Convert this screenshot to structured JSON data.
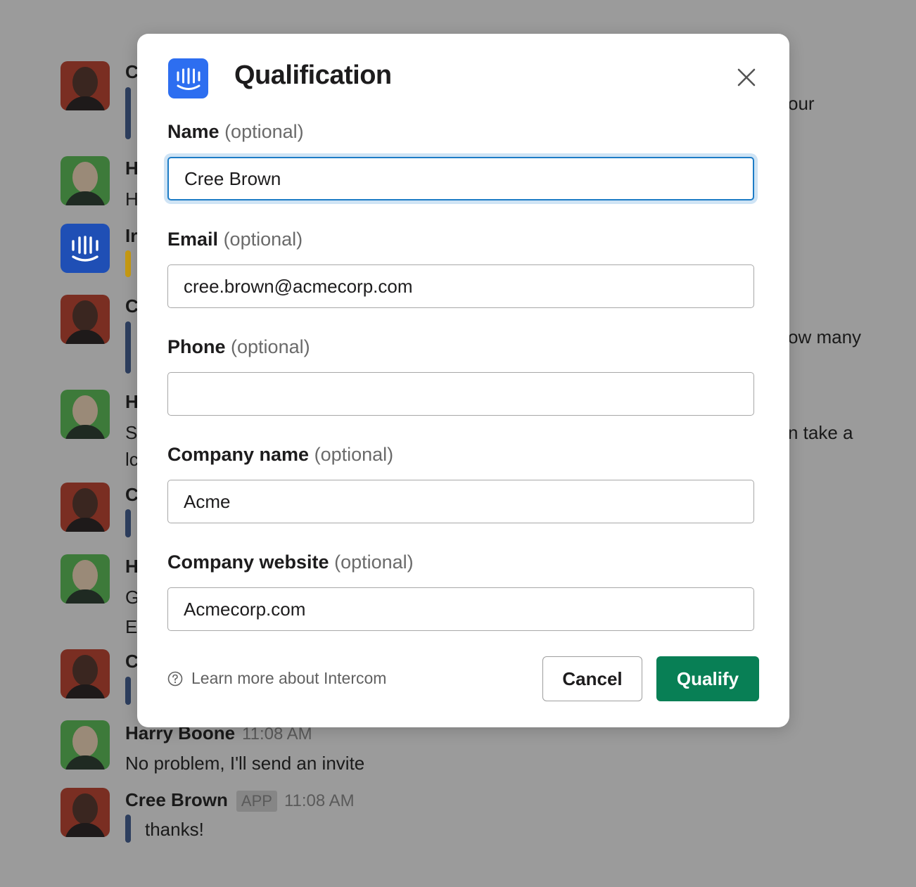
{
  "background_chat": {
    "messages": [
      {
        "author": "C",
        "text": "",
        "right_text": "our"
      },
      {
        "author": "H",
        "text": "H",
        "right_text": ""
      },
      {
        "author": "Ir",
        "text": "",
        "right_text": ""
      },
      {
        "author": "C",
        "text": "",
        "right_text": "ow many"
      },
      {
        "author": "H",
        "text": "S",
        "text2": "lc",
        "right_text": "n take a"
      },
      {
        "author": "C",
        "text": "",
        "right_text": ""
      },
      {
        "author": "H",
        "text": "G",
        "text2": "E",
        "right_text": ""
      },
      {
        "author": "C",
        "text": "",
        "right_text": ""
      },
      {
        "author": "Harry Boone",
        "time": "11:08 AM",
        "text": "No problem, I'll send an invite"
      },
      {
        "author": "Cree Brown",
        "badge": "APP",
        "time": "11:08 AM",
        "text": "thanks!"
      }
    ]
  },
  "modal": {
    "title": "Qualification",
    "logo_icon": "intercom-logo-icon",
    "close_icon": "close-icon",
    "fields": [
      {
        "label": "Name",
        "optional": "(optional)",
        "value": "Cree Brown",
        "focused": true
      },
      {
        "label": "Email",
        "optional": "(optional)",
        "value": "cree.brown@acmecorp.com"
      },
      {
        "label": "Phone",
        "optional": "(optional)",
        "value": ""
      },
      {
        "label": "Company name",
        "optional": "(optional)",
        "value": "Acme"
      },
      {
        "label": "Company website",
        "optional": "(optional)",
        "value": "Acmecorp.com"
      }
    ],
    "learn_more": "Learn more about Intercom",
    "cancel_label": "Cancel",
    "qualify_label": "Qualify"
  },
  "colors": {
    "overlay": "#9b9b9b",
    "primary_button": "#087f55",
    "focus_border": "#1d7cc6",
    "intercom_blue": "#2d6ef0"
  }
}
